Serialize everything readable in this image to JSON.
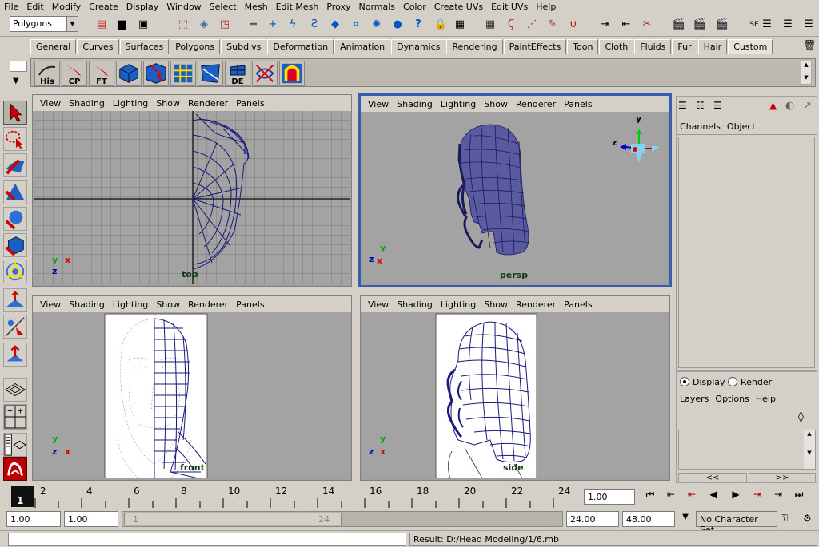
{
  "menubar": [
    "File",
    "Edit",
    "Modify",
    "Create",
    "Display",
    "Window",
    "Select",
    "Mesh",
    "Edit Mesh",
    "Proxy",
    "Normals",
    "Color",
    "Create UVs",
    "Edit UVs",
    "Help"
  ],
  "status_line": {
    "mode": "Polygons"
  },
  "shelf_tabs": [
    "General",
    "Curves",
    "Surfaces",
    "Polygons",
    "Subdivs",
    "Deformation",
    "Animation",
    "Dynamics",
    "Rendering",
    "PaintEffects",
    "Toon",
    "Cloth",
    "Fluids",
    "Fur",
    "Hair",
    "Custom"
  ],
  "shelf_tab_active": "Custom",
  "shelf_buttons": [
    "His",
    "CP",
    "FT",
    "",
    "",
    "",
    "",
    "DE",
    "",
    ""
  ],
  "viewport_menu": [
    "View",
    "Shading",
    "Lighting",
    "Show",
    "Renderer",
    "Panels"
  ],
  "viewports": {
    "top": "top",
    "persp": "persp",
    "front": "front",
    "side": "side"
  },
  "axes": {
    "x": "x",
    "y": "y",
    "z": "z"
  },
  "channel_box": {
    "channels": "Channels",
    "object": "Object"
  },
  "layer_editor": {
    "display": "Display",
    "render": "Render",
    "menu": [
      "Layers",
      "Options",
      "Help"
    ],
    "prev": "<<",
    "next": ">>"
  },
  "timeline": {
    "ticks": [
      "1",
      "2",
      "4",
      "6",
      "8",
      "10",
      "12",
      "14",
      "16",
      "18",
      "20",
      "22",
      "24"
    ],
    "current_time": "1.00"
  },
  "range": {
    "start": "1.00",
    "playback_start": "1.00",
    "slider_start": "1",
    "slider_end": "24",
    "playback_end": "24.00",
    "end": "48.00",
    "character_set": "No Character Set"
  },
  "command_line": {
    "result": "Result: D:/Head Modeling/1/6.mb"
  },
  "colors": {
    "active_border": "#3a5fa8",
    "wire": "#1a1a7a",
    "viewport_bg": "#a3a3a3"
  }
}
